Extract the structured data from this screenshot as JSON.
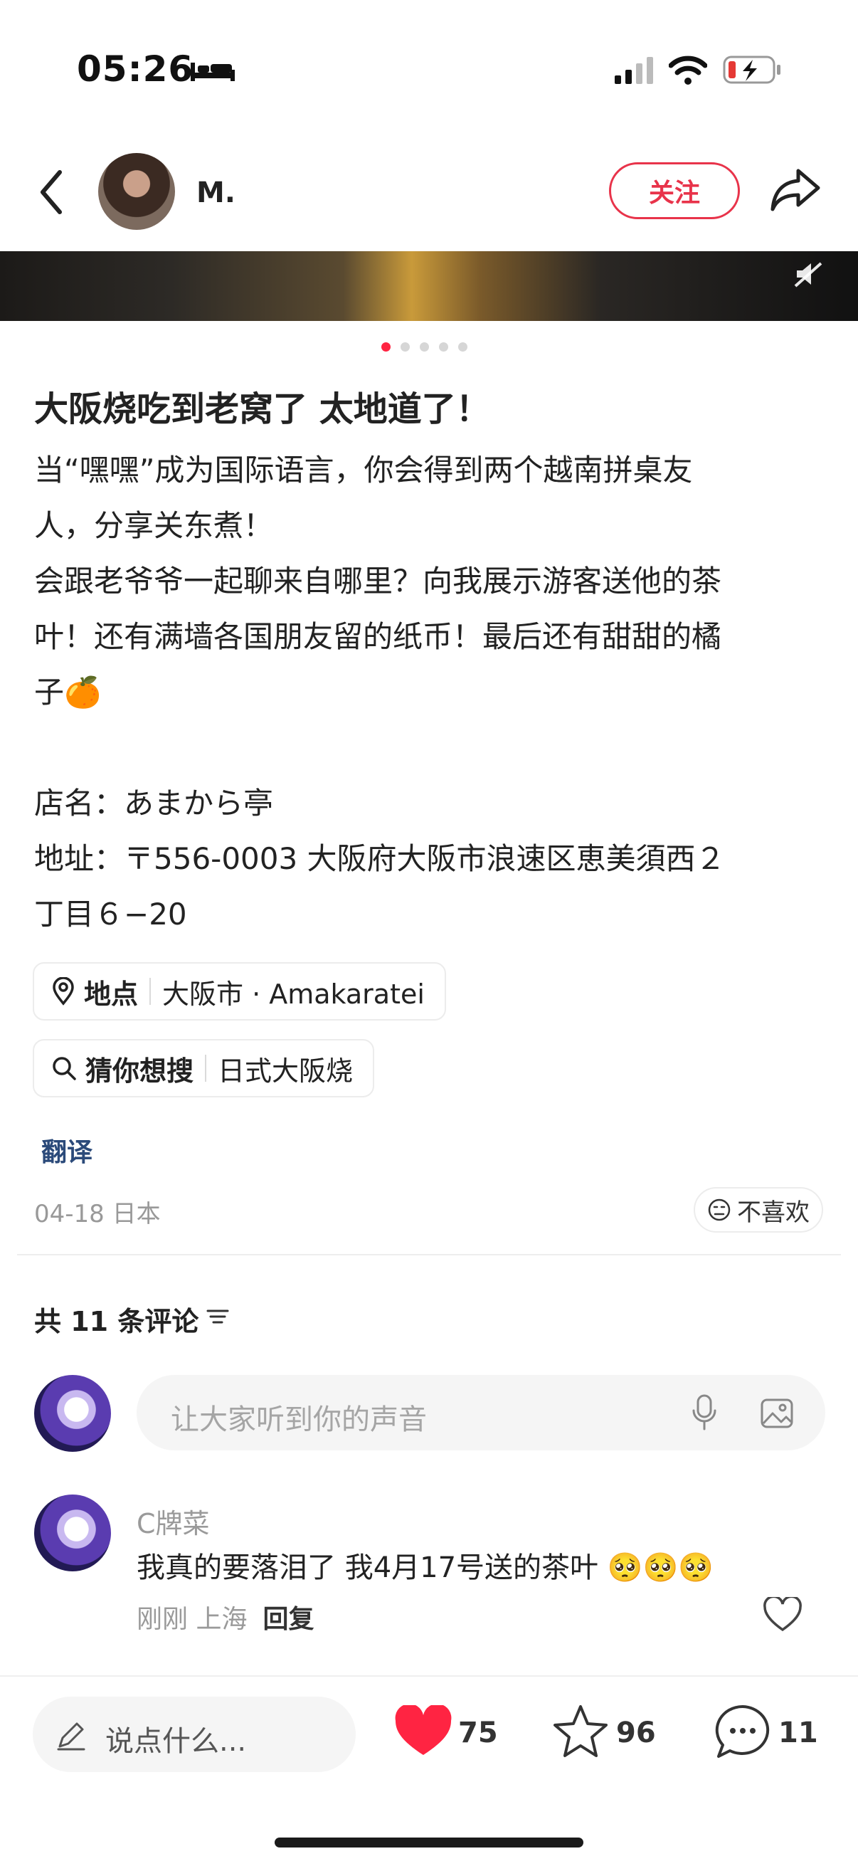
{
  "status_bar": {
    "time": "05:26"
  },
  "header": {
    "username": "M.",
    "follow_label": "关注"
  },
  "post": {
    "title": "大阪烧吃到老窝了 太地道了！",
    "body": "当“嘿嘿”成为国际语言，你会得到两个越南拼桌友\n人，分享关东煮！\n会跟老爷爷一起聊来自哪里？向我展示游客送他的茶\n叶！还有满墙各国朋友留的纸币！最后还有甜甜的橘\n子🍊\n\n店名：あまから亭\n地址：〒556-0003 大阪府大阪市浪速区恵美須西２\n丁目６−20"
  },
  "tags": [
    {
      "key": "地点",
      "value": "大阪市 · Amakaratei",
      "icon": "location-pin-icon"
    },
    {
      "key": "猜你想搜",
      "value": "日式大阪烧",
      "icon": "search-icon"
    }
  ],
  "translate_label": "翻译",
  "meta": {
    "date_location": "04-18 日本",
    "dislike_label": "不喜欢"
  },
  "comments_section": {
    "count_label": "共 11 条评论",
    "input_placeholder": "让大家听到你的声音",
    "comments": [
      {
        "author": "C牌菜",
        "text": "我真的要落泪了 我4月17号送的茶叶 🥺🥺🥺",
        "time_location": "刚刚 上海",
        "reply_label": "回复"
      }
    ]
  },
  "bottom_bar": {
    "say_placeholder": "说点什么...",
    "likes": "75",
    "favorites": "96",
    "comments": "11"
  },
  "colors": {
    "accent": "#ff2442",
    "follow": "#e8334a"
  }
}
